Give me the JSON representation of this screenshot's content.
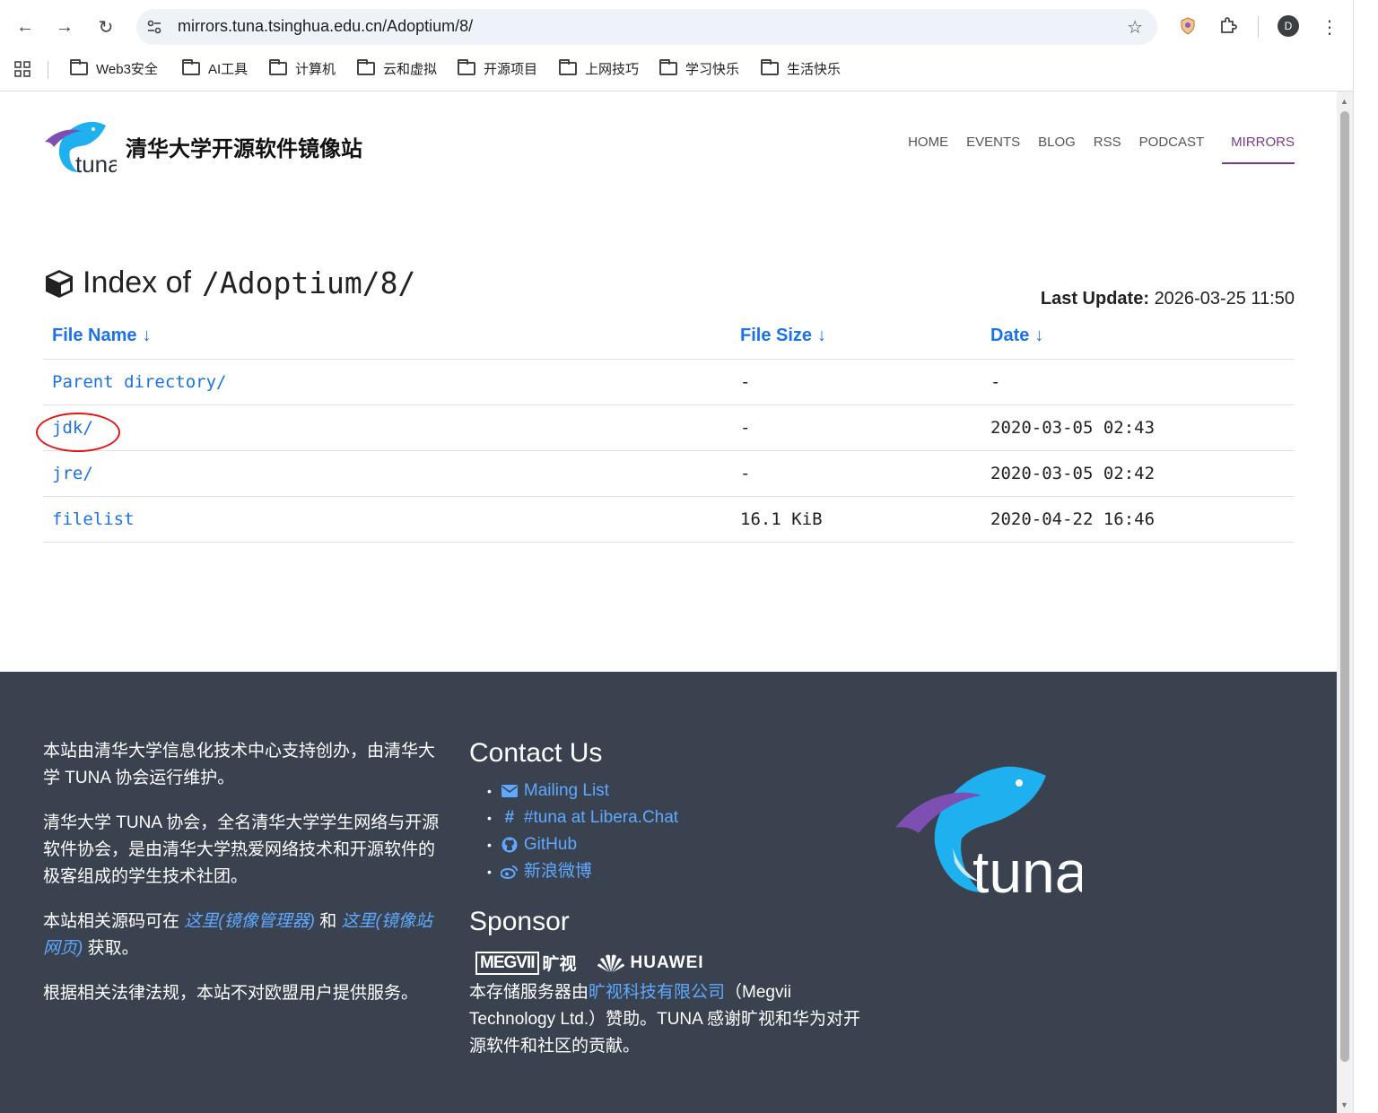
{
  "browser": {
    "url": "mirrors.tuna.tsinghua.edu.cn/Adoptium/8/",
    "avatar_letter": "D",
    "bookmarks": [
      "Web3安全",
      "AI工具",
      "计算机",
      "云和虚拟",
      "开源项目",
      "上网技巧",
      "学习快乐",
      "生活快乐"
    ]
  },
  "site": {
    "logo_text": "tuna",
    "title": "清华大学开源软件镜像站",
    "nav": [
      "HOME",
      "EVENTS",
      "BLOG",
      "RSS",
      "PODCAST",
      "MIRRORS"
    ],
    "active_nav": "MIRRORS"
  },
  "listing": {
    "label": "Index of",
    "path": "/Adoptium/8/",
    "last_update_label": "Last Update:",
    "last_update_value": "2026-03-25 11:50",
    "headers": {
      "name": "File Name",
      "size": "File Size",
      "date": "Date",
      "sort_arrow": "↓"
    },
    "rows": [
      {
        "name": "Parent directory/",
        "size": "-",
        "date": "-"
      },
      {
        "name": "jdk/",
        "size": "-",
        "date": "2020-03-05 02:43"
      },
      {
        "name": "jre/",
        "size": "-",
        "date": "2020-03-05 02:42"
      },
      {
        "name": "filelist",
        "size": "16.1 KiB",
        "date": "2020-04-22 16:46"
      }
    ]
  },
  "footer": {
    "about1": "本站由清华大学信息化技术中心支持创办，由清华大学 TUNA 协会运行维护。",
    "about2": "清华大学 TUNA 协会，全名清华大学学生网络与开源软件协会，是由清华大学热爱网络技术和开源软件的极客组成的学生技术社团。",
    "about3_pre": "本站相关源码可在 ",
    "about3_link1": "这里(镜像管理器)",
    "about3_mid": " 和 ",
    "about3_link2": "这里(镜像站网页)",
    "about3_post": " 获取。",
    "about4": "根据相关法律法规，本站不对欧盟用户提供服务。",
    "contact_title": "Contact Us",
    "contacts": [
      "Mailing List",
      "#tuna at Libera.Chat",
      "GitHub",
      "新浪微博"
    ],
    "sponsor_title": "Sponsor",
    "sponsor_megvii": "MEGVII",
    "sponsor_megvii_cn": "旷视",
    "sponsor_huawei": "HUAWEI",
    "sponsor_pre": "本存储服务器由",
    "sponsor_link": "旷视科技有限公司",
    "sponsor_post": "（Megvii Technology Ltd.）赞助。TUNA 感谢旷视和华为对开源软件和社区的贡献。",
    "logo_text": "tuna"
  },
  "colors": {
    "link": "#1a73e8",
    "footer_bg": "#3a4250",
    "active_nav": "#7a3b8f",
    "annotation": "#e01818"
  }
}
